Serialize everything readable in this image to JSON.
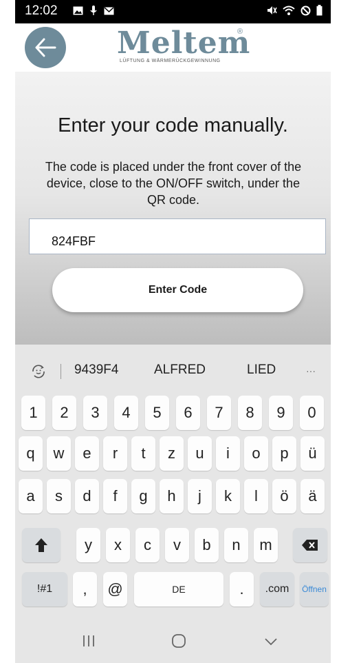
{
  "status_bar": {
    "time": "12:02"
  },
  "header": {
    "logo_text": "Meltem",
    "logo_subtitle": "LÜFTUNG & WÄRMERÜCKGEWINNUNG",
    "logo_mark": "®"
  },
  "main": {
    "title": "Enter your code manually.",
    "description": "The code is placed under the front cover of the device, close to the ON/OFF switch, under the QR code.",
    "code_value": "824FBF",
    "enter_button": "Enter Code"
  },
  "keyboard": {
    "suggestions": [
      "9439F4",
      "ALFRED",
      "LIED"
    ],
    "more": "···",
    "row_numbers": [
      "1",
      "2",
      "3",
      "4",
      "5",
      "6",
      "7",
      "8",
      "9",
      "0"
    ],
    "row_q": [
      "q",
      "w",
      "e",
      "r",
      "t",
      "z",
      "u",
      "i",
      "o",
      "p",
      "ü"
    ],
    "row_a": [
      "a",
      "s",
      "d",
      "f",
      "g",
      "h",
      "j",
      "k",
      "l",
      "ö",
      "ä"
    ],
    "row_y": [
      "y",
      "x",
      "c",
      "v",
      "b",
      "n",
      "m"
    ],
    "symbols_key": "!#1",
    "comma_key": ",",
    "at_key": "@",
    "space_key": "DE",
    "period_key": ".",
    "dotcom_key": ".com",
    "enter_key": "Öffnen"
  },
  "colors": {
    "accent": "#6e8b9a",
    "keyboard_bg": "#e6e6e6",
    "key_bg": "#fdfdfd",
    "action_blue": "#3b8ad6"
  }
}
